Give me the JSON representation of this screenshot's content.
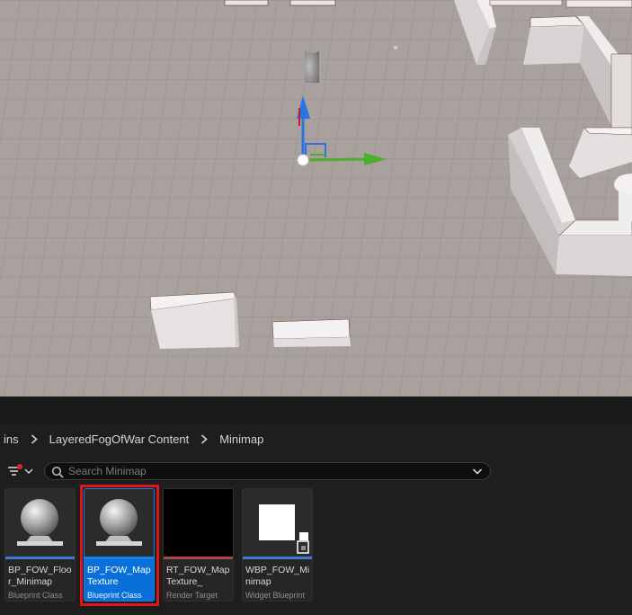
{
  "breadcrumb": {
    "items": [
      "ins",
      "LayeredFogOfWar Content",
      "Minimap"
    ]
  },
  "search": {
    "placeholder": "Search Minimap",
    "value": ""
  },
  "assets": [
    {
      "name": "BP_FOW_Floor_Minimap",
      "type": "Blueprint Class",
      "thumbnail": "sphere-icon",
      "stripe_color": "#3f7bd6",
      "selected": false
    },
    {
      "name": "BP_FOW_MapTexture",
      "type": "Blueprint Class",
      "thumbnail": "sphere-icon",
      "stripe_color": "#3f7bd6",
      "selected": true
    },
    {
      "name": "RT_FOW_MapTexture_",
      "type": "Render Target",
      "thumbnail": "black-texture",
      "stripe_color": "#b04545",
      "selected": false
    },
    {
      "name": "WBP_FOW_Minimap",
      "type": "Widget Blueprint",
      "thumbnail": "widget-icon",
      "stripe_color": "#3f7bd6",
      "selected": false
    }
  ],
  "colors": {
    "selection_highlight": "#0a70d9",
    "annotation_outline": "#e2141b",
    "gizmo_x": "#4fae2b",
    "gizmo_z": "#2e73e0"
  }
}
